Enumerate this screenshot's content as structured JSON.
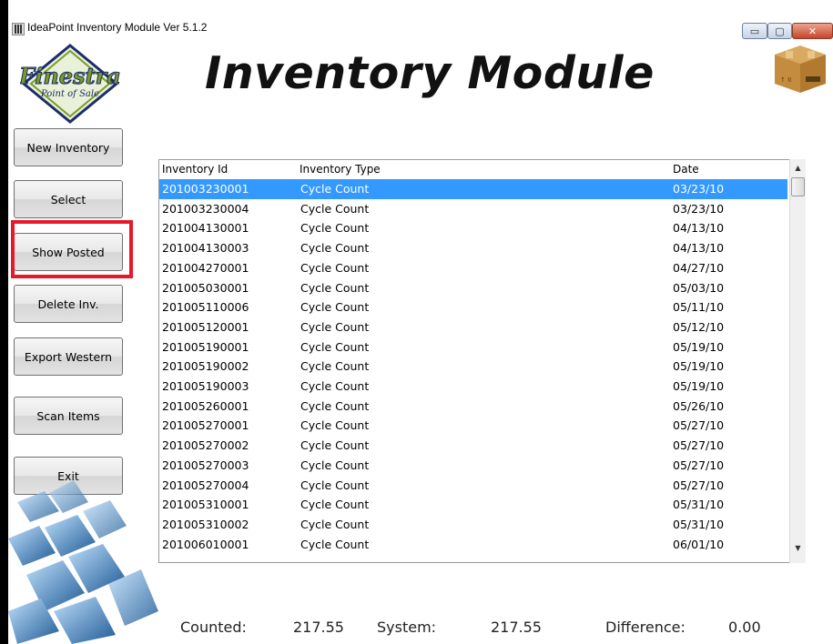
{
  "window": {
    "title": "IdeaPoint Inventory Module Ver 5.1.2",
    "controls": {
      "minimize": "▭",
      "maximize": "▢",
      "close": "✕"
    }
  },
  "header": {
    "heading": "Inventory Module",
    "logo": {
      "name": "Finestra",
      "tagline": "Point of Sale",
      "icon": "finestra-logo"
    },
    "box_icon": "cardboard-box-icon"
  },
  "sidebar": {
    "buttons": [
      {
        "label": "New Inventory"
      },
      {
        "label": "Select"
      },
      {
        "label": "Show Posted"
      },
      {
        "label": "Delete Inv."
      },
      {
        "label": "Export Western"
      },
      {
        "label": "Scan Items"
      },
      {
        "label": "Exit"
      }
    ]
  },
  "table": {
    "columns": [
      "Inventory Id",
      "Inventory Type",
      "Date"
    ],
    "rows": [
      {
        "id": "201003230001",
        "type": "Cycle Count",
        "date": "03/23/10"
      },
      {
        "id": "201003230004",
        "type": "Cycle Count",
        "date": "03/23/10"
      },
      {
        "id": "201004130001",
        "type": "Cycle Count",
        "date": "04/13/10"
      },
      {
        "id": "201004130003",
        "type": "Cycle Count",
        "date": "04/13/10"
      },
      {
        "id": "201004270001",
        "type": "Cycle Count",
        "date": "04/27/10"
      },
      {
        "id": "201005030001",
        "type": "Cycle Count",
        "date": "05/03/10"
      },
      {
        "id": "201005110006",
        "type": "Cycle Count",
        "date": "05/11/10"
      },
      {
        "id": "201005120001",
        "type": "Cycle Count",
        "date": "05/12/10"
      },
      {
        "id": "201005190001",
        "type": "Cycle Count",
        "date": "05/19/10"
      },
      {
        "id": "201005190002",
        "type": "Cycle Count",
        "date": "05/19/10"
      },
      {
        "id": "201005190003",
        "type": "Cycle Count",
        "date": "05/19/10"
      },
      {
        "id": "201005260001",
        "type": "Cycle Count",
        "date": "05/26/10"
      },
      {
        "id": "201005270001",
        "type": "Cycle Count",
        "date": "05/27/10"
      },
      {
        "id": "201005270002",
        "type": "Cycle Count",
        "date": "05/27/10"
      },
      {
        "id": "201005270003",
        "type": "Cycle Count",
        "date": "05/27/10"
      },
      {
        "id": "201005270004",
        "type": "Cycle Count",
        "date": "05/27/10"
      },
      {
        "id": "201005310001",
        "type": "Cycle Count",
        "date": "05/31/10"
      },
      {
        "id": "201005310002",
        "type": "Cycle Count",
        "date": "05/31/10"
      },
      {
        "id": "201006010001",
        "type": "Cycle Count",
        "date": "06/01/10"
      }
    ],
    "selected_row": 0
  },
  "totals": {
    "counted_label": "Counted:",
    "counted_value": "217.55",
    "system_label": "System:",
    "system_value": "217.55",
    "difference_label": "Difference:",
    "difference_value": "0.00"
  },
  "colors": {
    "selection": "#3399ff",
    "highlight_box": "#e8182b",
    "logo_green": "#7a9b2a",
    "logo_navy": "#1d2d6b"
  }
}
